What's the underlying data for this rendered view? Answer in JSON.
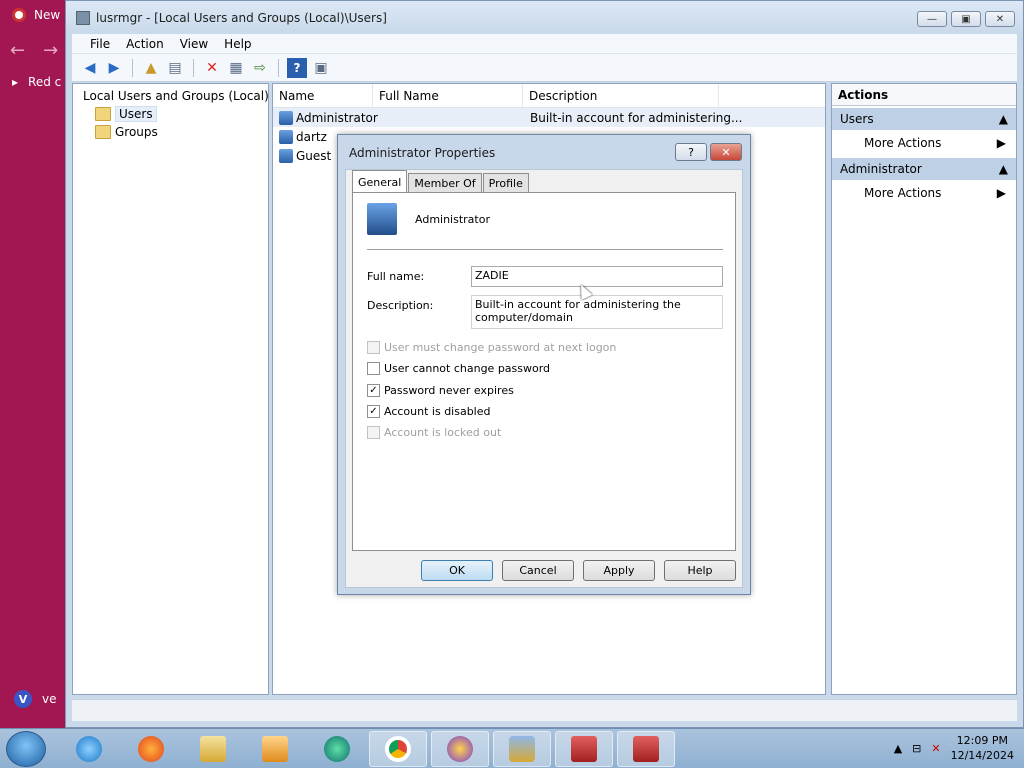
{
  "background_browser": {
    "tab_label": "New",
    "bookmark_label": "Red c",
    "bottom_label": "ve"
  },
  "window": {
    "title": "lusrmgr - [Local Users and Groups (Local)\\Users]",
    "controls": [
      "minimize",
      "restore",
      "close"
    ]
  },
  "menubar": [
    "File",
    "Action",
    "View",
    "Help"
  ],
  "toolbar_icons": [
    "back-icon",
    "forward-icon",
    "up-icon",
    "show-hide-tree-icon",
    "delete-icon",
    "properties-icon",
    "export-icon",
    "help-icon",
    "console-icon"
  ],
  "tree": {
    "root": "Local Users and Groups (Local)",
    "children": [
      {
        "label": "Users",
        "selected": true
      },
      {
        "label": "Groups",
        "selected": false
      }
    ]
  },
  "list": {
    "columns": [
      "Name",
      "Full Name",
      "Description"
    ],
    "rows": [
      {
        "name": "Administrator",
        "full_name": "",
        "description": "Built-in account for administering..."
      },
      {
        "name": "dartz",
        "full_name": "",
        "description": ""
      },
      {
        "name": "Guest",
        "full_name": "",
        "description": ""
      }
    ]
  },
  "actions": {
    "header": "Actions",
    "sections": [
      {
        "title": "Users",
        "item": "More Actions"
      },
      {
        "title": "Administrator",
        "item": "More Actions"
      }
    ]
  },
  "dialog": {
    "title": "Administrator Properties",
    "help_glyph": "?",
    "close_glyph": "✕",
    "tabs": [
      "General",
      "Member Of",
      "Profile"
    ],
    "active_tab": "General",
    "user_name": "Administrator",
    "full_name_label": "Full name:",
    "full_name_value": "ZADIE",
    "description_label": "Description:",
    "description_value": "Built-in account for administering the computer/domain",
    "checkboxes": [
      {
        "label": "User must change password at next logon",
        "checked": false,
        "enabled": false
      },
      {
        "label": "User cannot change password",
        "checked": false,
        "enabled": true
      },
      {
        "label": "Password never expires",
        "checked": true,
        "enabled": true
      },
      {
        "label": "Account is disabled",
        "checked": true,
        "enabled": true
      },
      {
        "label": "Account is locked out",
        "checked": false,
        "enabled": false
      }
    ],
    "buttons": {
      "ok": "OK",
      "cancel": "Cancel",
      "apply": "Apply",
      "help": "Help"
    }
  },
  "taskbar": {
    "time": "12:09 PM",
    "date": "12/14/2024",
    "pinned": [
      "internet-explorer-icon",
      "firefox-icon",
      "file-explorer-icon",
      "media-player-icon",
      "edge-icon",
      "chrome-icon",
      "vpn-icon",
      "user-accounts-icon",
      "toolbox-icon",
      "toolbox-icon"
    ]
  },
  "colors": {
    "desktop": "#9b1a4f",
    "window_frame": "#c9d9ea",
    "selection": "#e8eef7"
  }
}
